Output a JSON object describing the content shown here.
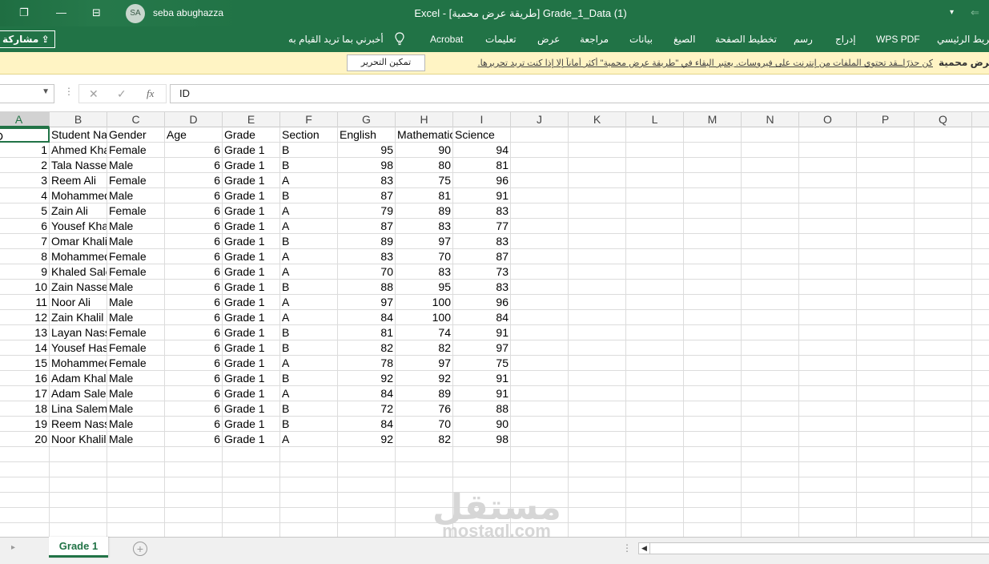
{
  "titlebar": {
    "restore_icon": "restore-window-icon",
    "minimize_icon": "minimize-icon",
    "ribbon_display_icon": "ribbon-display-options-icon",
    "avatar_initials": "SA",
    "username": "seba abughazza",
    "doc_title": "Excel  -  [طريقة عرض محمية]  Grade_1_Data (1)",
    "more_icon": "dropdown-icon"
  },
  "ribbon": {
    "share_label": "مشاركة",
    "tell_me": "أخبرني بما تريد القيام به",
    "tabs": [
      "Acrobat",
      "تعليمات",
      "عرض",
      "مراجعة",
      "بيانات",
      "الصيغ",
      "تخطيط الصفحة",
      "رسم",
      "إدراج",
      "WPS PDF",
      "الشريط الرئيسي"
    ]
  },
  "msgbar": {
    "title": "طريقة عرض محمية",
    "message": "كن حذرًاــقد تحتوي الملفات من إنترنت على فيروسات. يعتبر البقاء في \"طريقة عرض محمية\" أكثر أماناً إلا إذا كنت تريد تحريرها.",
    "enable_button": "تمكين التحرير"
  },
  "formula_bar": {
    "name_box": "",
    "fx": "fx",
    "cancel_icon": "✕",
    "enter_icon": "✓",
    "content": "ID"
  },
  "grid": {
    "columns": [
      "A",
      "B",
      "C",
      "D",
      "E",
      "F",
      "G",
      "H",
      "I",
      "J",
      "K",
      "L",
      "M",
      "N",
      "O",
      "P",
      "Q"
    ],
    "header_row": [
      "ID",
      "Student Name",
      "Gender",
      "Age",
      "Grade",
      "Section",
      "English",
      "Mathematics",
      "Science"
    ],
    "rows": [
      [
        "1",
        "Ahmed Khalil",
        "Female",
        "6",
        "Grade 1",
        "B",
        "95",
        "90",
        "94"
      ],
      [
        "2",
        "Tala Nasser",
        "Male",
        "6",
        "Grade 1",
        "B",
        "98",
        "80",
        "81"
      ],
      [
        "3",
        "Reem Ali",
        "Female",
        "6",
        "Grade 1",
        "A",
        "83",
        "75",
        "96"
      ],
      [
        "4",
        "Mohammed",
        "Male",
        "6",
        "Grade 1",
        "B",
        "87",
        "81",
        "91"
      ],
      [
        "5",
        "Zain Ali",
        "Female",
        "6",
        "Grade 1",
        "A",
        "79",
        "89",
        "83"
      ],
      [
        "6",
        "Yousef Khalil",
        "Male",
        "6",
        "Grade 1",
        "A",
        "87",
        "83",
        "77"
      ],
      [
        "7",
        "Omar Khalil",
        "Male",
        "6",
        "Grade 1",
        "B",
        "89",
        "97",
        "83"
      ],
      [
        "8",
        "Mohammed",
        "Female",
        "6",
        "Grade 1",
        "A",
        "83",
        "70",
        "87"
      ],
      [
        "9",
        "Khaled Saleh",
        "Female",
        "6",
        "Grade 1",
        "A",
        "70",
        "83",
        "73"
      ],
      [
        "10",
        "Zain Nasser",
        "Male",
        "6",
        "Grade 1",
        "B",
        "88",
        "95",
        "83"
      ],
      [
        "11",
        "Noor Ali",
        "Male",
        "6",
        "Grade 1",
        "A",
        "97",
        "100",
        "96"
      ],
      [
        "12",
        "Zain Khalil",
        "Male",
        "6",
        "Grade 1",
        "A",
        "84",
        "100",
        "84"
      ],
      [
        "13",
        "Layan Nasser",
        "Female",
        "6",
        "Grade 1",
        "B",
        "81",
        "74",
        "91"
      ],
      [
        "14",
        "Yousef Hassan",
        "Female",
        "6",
        "Grade 1",
        "B",
        "82",
        "82",
        "97"
      ],
      [
        "15",
        "Mohammed",
        "Female",
        "6",
        "Grade 1",
        "A",
        "78",
        "97",
        "75"
      ],
      [
        "16",
        "Adam Khalil",
        "Male",
        "6",
        "Grade 1",
        "B",
        "92",
        "92",
        "91"
      ],
      [
        "17",
        "Adam Saleh",
        "Male",
        "6",
        "Grade 1",
        "A",
        "84",
        "89",
        "91"
      ],
      [
        "18",
        "Lina Salem",
        "Male",
        "6",
        "Grade 1",
        "B",
        "72",
        "76",
        "88"
      ],
      [
        "19",
        "Reem Nasser",
        "Male",
        "6",
        "Grade 1",
        "B",
        "84",
        "70",
        "90"
      ],
      [
        "20",
        "Noor Khalil",
        "Male",
        "6",
        "Grade 1",
        "A",
        "92",
        "82",
        "98"
      ]
    ]
  },
  "watermark": {
    "arabic": "مستقل",
    "latin": "mostaql.com"
  },
  "sheets": {
    "active": "Grade 1",
    "add_icon": "add-sheet-icon"
  },
  "colors": {
    "accent": "#217346",
    "msgbar": "#fff4c4"
  }
}
